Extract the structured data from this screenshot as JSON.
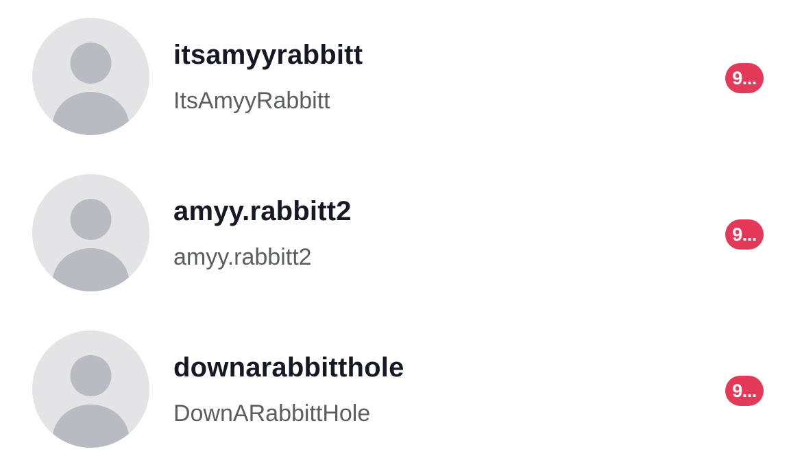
{
  "accounts": [
    {
      "username": "itsamyyrabbitt",
      "display_name": "ItsAmyyRabbitt",
      "badge": "9..."
    },
    {
      "username": "amyy.rabbitt2",
      "display_name": "amyy.rabbitt2",
      "badge": "9..."
    },
    {
      "username": "downarabbitthole",
      "display_name": "DownARabbittHole",
      "badge": "9..."
    }
  ],
  "colors": {
    "badge": "#e5395a",
    "username": "#161823",
    "display_name": "#5b5d63",
    "avatar_placeholder": "#e4e4e7"
  }
}
